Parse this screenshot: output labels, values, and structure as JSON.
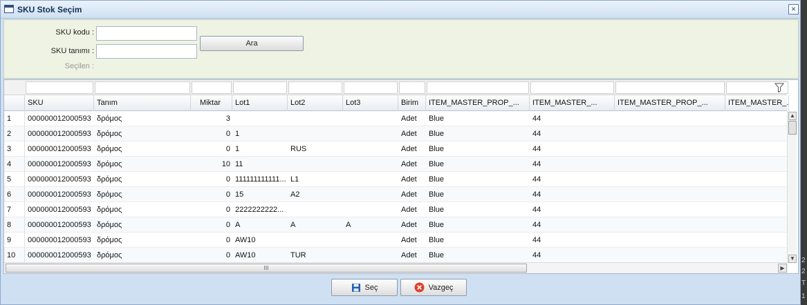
{
  "window": {
    "title": "SKU Stok Seçim",
    "close_glyph": "×"
  },
  "filter": {
    "sku_code_label": "SKU kodu :",
    "sku_code_value": "",
    "sku_desc_label": "SKU tanımı :",
    "sku_desc_value": "",
    "selected_label": "Seçilen :",
    "search_button": "Ara"
  },
  "grid": {
    "columns": [
      "SKU",
      "Tanım",
      "Miktar",
      "Lot1",
      "Lot2",
      "Lot3",
      "Birim",
      "ITEM_MASTER_PROP_...",
      "ITEM_MASTER_...",
      "ITEM_MASTER_PROP_...",
      "ITEM_MASTER_..."
    ],
    "rows": [
      {
        "n": "1",
        "sku": "000000012000593",
        "tanim": "δρόμος",
        "miktar": "3",
        "lot1": "",
        "lot2": "",
        "lot3": "",
        "birim": "Adet",
        "p1": "Blue",
        "p2": "44"
      },
      {
        "n": "2",
        "sku": "000000012000593",
        "tanim": "δρόμος",
        "miktar": "0",
        "lot1": "1",
        "lot2": "",
        "lot3": "",
        "birim": "Adet",
        "p1": "Blue",
        "p2": "44"
      },
      {
        "n": "3",
        "sku": "000000012000593",
        "tanim": "δρόμος",
        "miktar": "0",
        "lot1": "1",
        "lot2": "RUS",
        "lot3": "",
        "birim": "Adet",
        "p1": "Blue",
        "p2": "44"
      },
      {
        "n": "4",
        "sku": "000000012000593",
        "tanim": "δρόμος",
        "miktar": "10",
        "lot1": "11",
        "lot2": "",
        "lot3": "",
        "birim": "Adet",
        "p1": "Blue",
        "p2": "44"
      },
      {
        "n": "5",
        "sku": "000000012000593",
        "tanim": "δρόμος",
        "miktar": "0",
        "lot1": "111111111111...",
        "lot2": "L1",
        "lot3": "",
        "birim": "Adet",
        "p1": "Blue",
        "p2": "44"
      },
      {
        "n": "6",
        "sku": "000000012000593",
        "tanim": "δρόμος",
        "miktar": "0",
        "lot1": "15",
        "lot2": "A2",
        "lot3": "",
        "birim": "Adet",
        "p1": "Blue",
        "p2": "44"
      },
      {
        "n": "7",
        "sku": "000000012000593",
        "tanim": "δρόμος",
        "miktar": "0",
        "lot1": "2222222222...",
        "lot2": "",
        "lot3": "",
        "birim": "Adet",
        "p1": "Blue",
        "p2": "44"
      },
      {
        "n": "8",
        "sku": "000000012000593",
        "tanim": "δρόμος",
        "miktar": "0",
        "lot1": "A",
        "lot2": "A",
        "lot3": "A",
        "birim": "Adet",
        "p1": "Blue",
        "p2": "44"
      },
      {
        "n": "9",
        "sku": "000000012000593",
        "tanim": "δρόμος",
        "miktar": "0",
        "lot1": "AW10",
        "lot2": "",
        "lot3": "",
        "birim": "Adet",
        "p1": "Blue",
        "p2": "44"
      },
      {
        "n": "10",
        "sku": "000000012000593",
        "tanim": "δρόμος",
        "miktar": "0",
        "lot1": "AW10",
        "lot2": "TUR",
        "lot3": "",
        "birim": "Adet",
        "p1": "Blue",
        "p2": "44"
      }
    ],
    "hscroll_grip": "III"
  },
  "footer": {
    "select_button": "Seç",
    "cancel_button": "Vazgeç"
  },
  "side_strip": [
    "2",
    "2",
    "T",
    "1"
  ],
  "colors": {
    "filter_bg": "#eef3e3",
    "window_bg": "#cfe0f3",
    "save_icon": "#1f5fb0",
    "cancel_icon": "#e0412b"
  }
}
